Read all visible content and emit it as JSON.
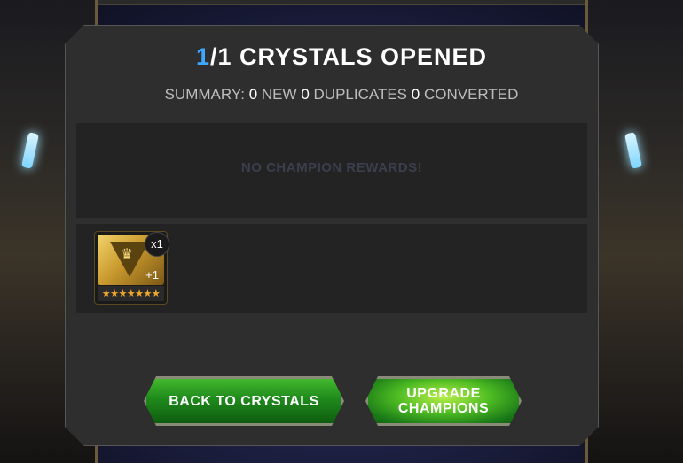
{
  "header": {
    "title_count": "1",
    "title_rest": "/1 CRYSTALS OPENED"
  },
  "summary": {
    "prefix": "SUMMARY:",
    "new_count": "0",
    "new_label": "NEW",
    "dup_count": "0",
    "dup_label": "DUPLICATES",
    "conv_count": "0",
    "conv_label": "CONVERTED"
  },
  "rewards": {
    "empty_message": "NO CHAMPION REWARDS!"
  },
  "items": [
    {
      "name_icon": "class-emblem-icon",
      "plus_text": "+1",
      "stars": "★★★★★★★",
      "star_count": 7,
      "quantity": "x1"
    }
  ],
  "buttons": {
    "back": "BACK TO CRYSTALS",
    "upgrade": "UPGRADE CHAMPIONS"
  },
  "colors": {
    "accent_blue": "#3ea8ff",
    "button_green": "#1f8a1c",
    "star_orange": "#f0a92c",
    "panel_bg": "#2e2e2e"
  }
}
